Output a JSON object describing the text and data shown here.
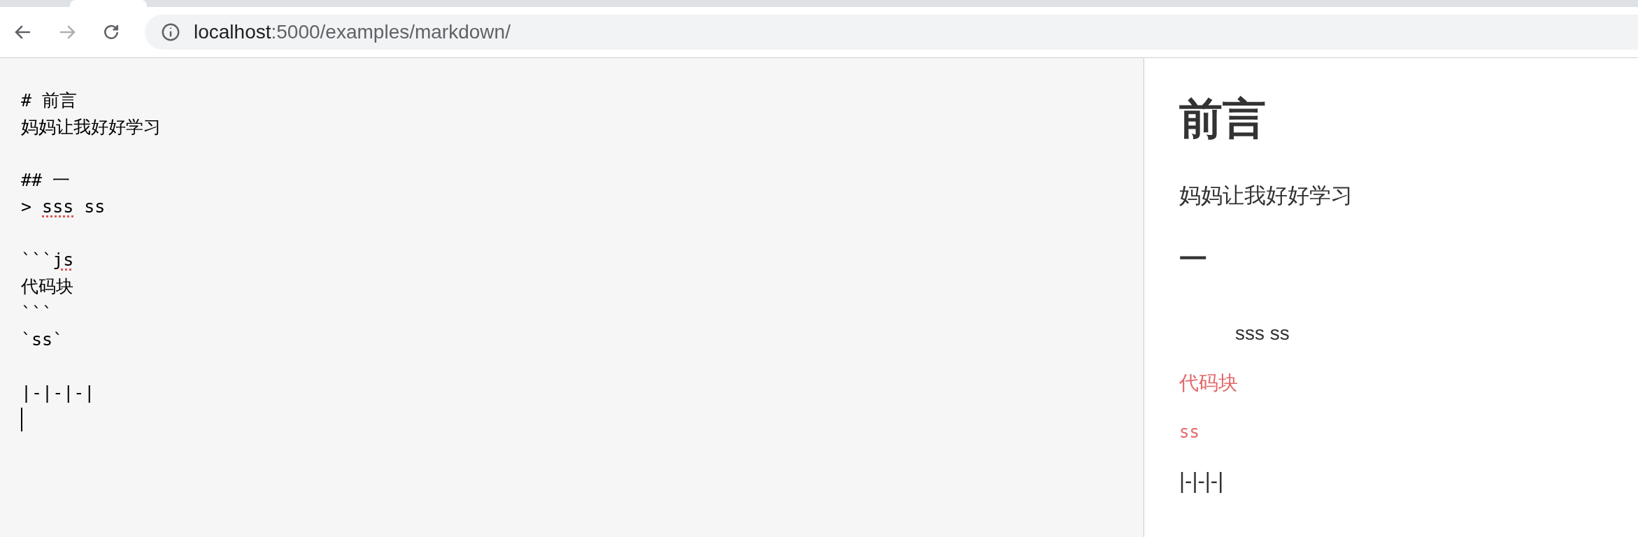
{
  "toolbar": {
    "back_disabled": false,
    "forward_disabled": true,
    "url_host": "localhost",
    "url_rest": ":5000/examples/markdown/"
  },
  "editor": {
    "cursor": true,
    "lines": [
      {
        "kind": "text",
        "segments": [
          {
            "text": "# 前言",
            "misspelled": false
          }
        ]
      },
      {
        "kind": "text",
        "segments": [
          {
            "text": "妈妈让我好好学习",
            "misspelled": false
          }
        ]
      },
      {
        "kind": "blank"
      },
      {
        "kind": "text",
        "segments": [
          {
            "text": "## 一",
            "misspelled": false
          }
        ]
      },
      {
        "kind": "text",
        "segments": [
          {
            "text": "> ",
            "misspelled": false
          },
          {
            "text": "sss",
            "misspelled": true
          },
          {
            "text": " ss",
            "misspelled": false
          }
        ]
      },
      {
        "kind": "blank"
      },
      {
        "kind": "text",
        "segments": [
          {
            "text": "```",
            "misspelled": false
          },
          {
            "text": "js",
            "misspelled": true
          }
        ]
      },
      {
        "kind": "text",
        "segments": [
          {
            "text": "代码块",
            "misspelled": false
          }
        ]
      },
      {
        "kind": "text",
        "segments": [
          {
            "text": "```",
            "misspelled": false
          }
        ]
      },
      {
        "kind": "text",
        "segments": [
          {
            "text": "`ss`",
            "misspelled": false
          }
        ]
      },
      {
        "kind": "blank"
      },
      {
        "kind": "text",
        "segments": [
          {
            "text": "|-|-|-|",
            "misspelled": false
          }
        ]
      }
    ]
  },
  "preview": [
    {
      "kind": "h1",
      "text": "前言"
    },
    {
      "kind": "p",
      "text": "妈妈让我好好学习"
    },
    {
      "kind": "h2",
      "text": "一"
    },
    {
      "kind": "blockquote",
      "text": "sss ss"
    },
    {
      "kind": "code",
      "text": "代码块"
    },
    {
      "kind": "inline_code",
      "text": "ss"
    },
    {
      "kind": "p",
      "text": "|-|-|-|"
    }
  ]
}
